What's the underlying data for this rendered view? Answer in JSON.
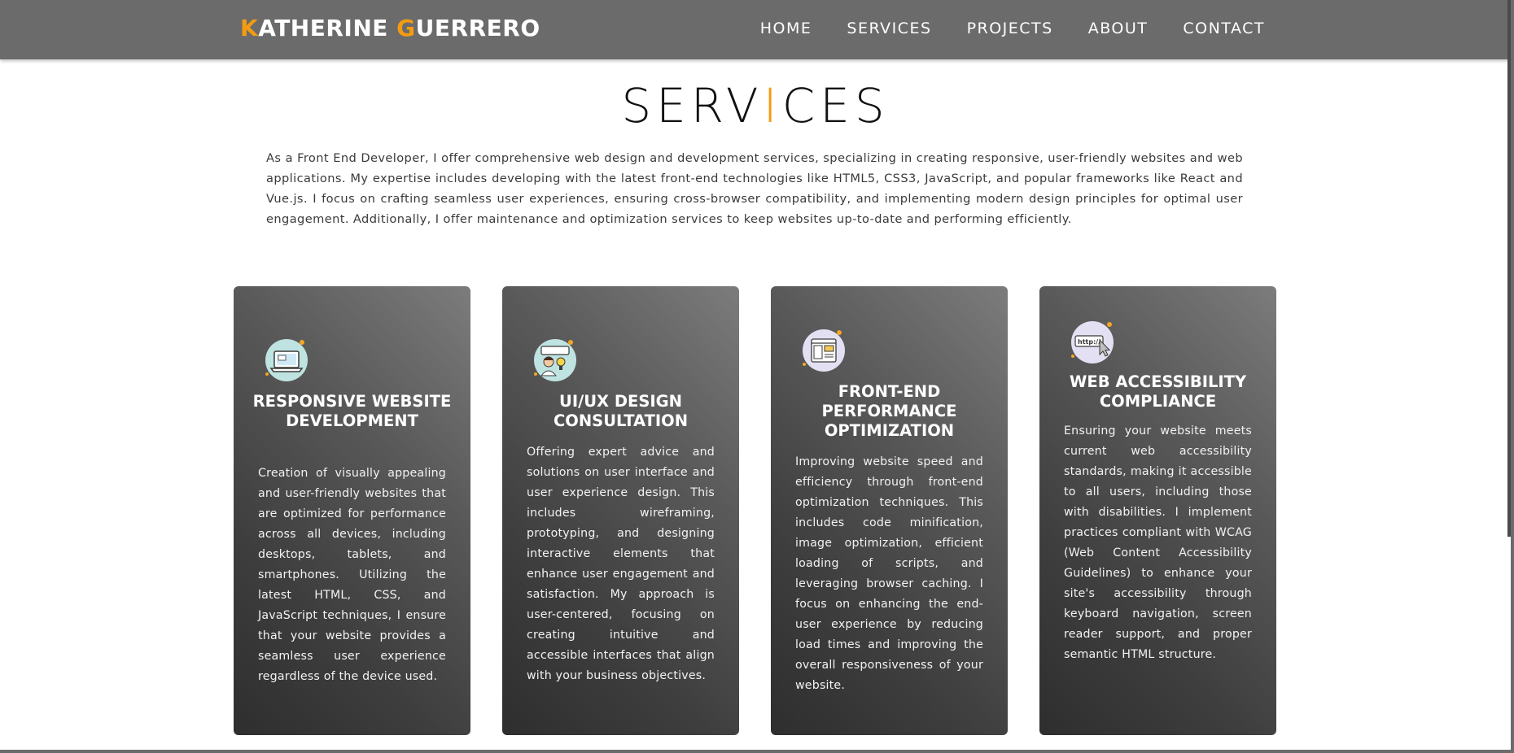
{
  "nav": {
    "brand_k": "K",
    "brand_rest1": "ATHERINE ",
    "brand_g": "G",
    "brand_rest2": "UERRERO",
    "links": [
      "HOME",
      "SERVICES",
      "PROJECTS",
      "ABOUT",
      "CONTACT"
    ]
  },
  "colors": {
    "accent": "#f39c12",
    "navbar": "#6b6b6b"
  },
  "services": {
    "title_part1": "SERV",
    "title_accent": "I",
    "title_part2": "CES",
    "intro": "As a Front End Developer, I offer comprehensive web design and development services, specializing in creating responsive, user-friendly websites and web applications. My expertise includes developing with the latest front-end technologies like HTML5, CSS3, JavaScript, and popular frameworks like React and Vue.js. I focus on crafting seamless user experiences, ensuring cross-browser compatibility, and implementing modern design principles for optimal user engagement. Additionally, I offer maintenance and optimization services to keep websites up-to-date and performing efficiently."
  },
  "cards": [
    {
      "icon": "laptop-icon",
      "title": "RESPONSIVE WEBSITE DEVELOPMENT",
      "text": "Creation of visually appealing and user-friendly websites that are optimized for performance across all devices, including desktops, tablets, and smartphones. Utilizing the latest HTML, CSS, and JavaScript techniques, I ensure that your website provides a seamless user experience regardless of the device used."
    },
    {
      "icon": "designer-lightbulb-icon",
      "title": "UI/UX DESIGN CONSULTATION",
      "text": "Offering expert advice and solutions on user interface and user experience design. This includes wireframing, prototyping, and designing interactive elements that enhance user engagement and satisfaction. My approach is user-centered, focusing on creating intuitive and accessible interfaces that align with your business objectives."
    },
    {
      "icon": "browser-layout-icon",
      "title": "FRONT-END PERFORMANCE OPTIMIZATION",
      "text": "Improving website speed and efficiency through front-end optimization techniques. This includes code minification, image optimization, efficient loading of scripts, and leveraging browser caching. I focus on enhancing the end-user experience by reducing load times and improving the overall responsiveness of your website."
    },
    {
      "icon": "url-cursor-icon",
      "title": "WEB ACCESSIBILITY COMPLIANCE",
      "text": "Ensuring your website meets current web accessibility standards, making it accessible to all users, including those with disabilities. I implement practices compliant with WCAG (Web Content Accessibility Guidelines) to enhance your site's accessibility through keyboard navigation, screen reader support, and proper semantic HTML structure."
    }
  ]
}
